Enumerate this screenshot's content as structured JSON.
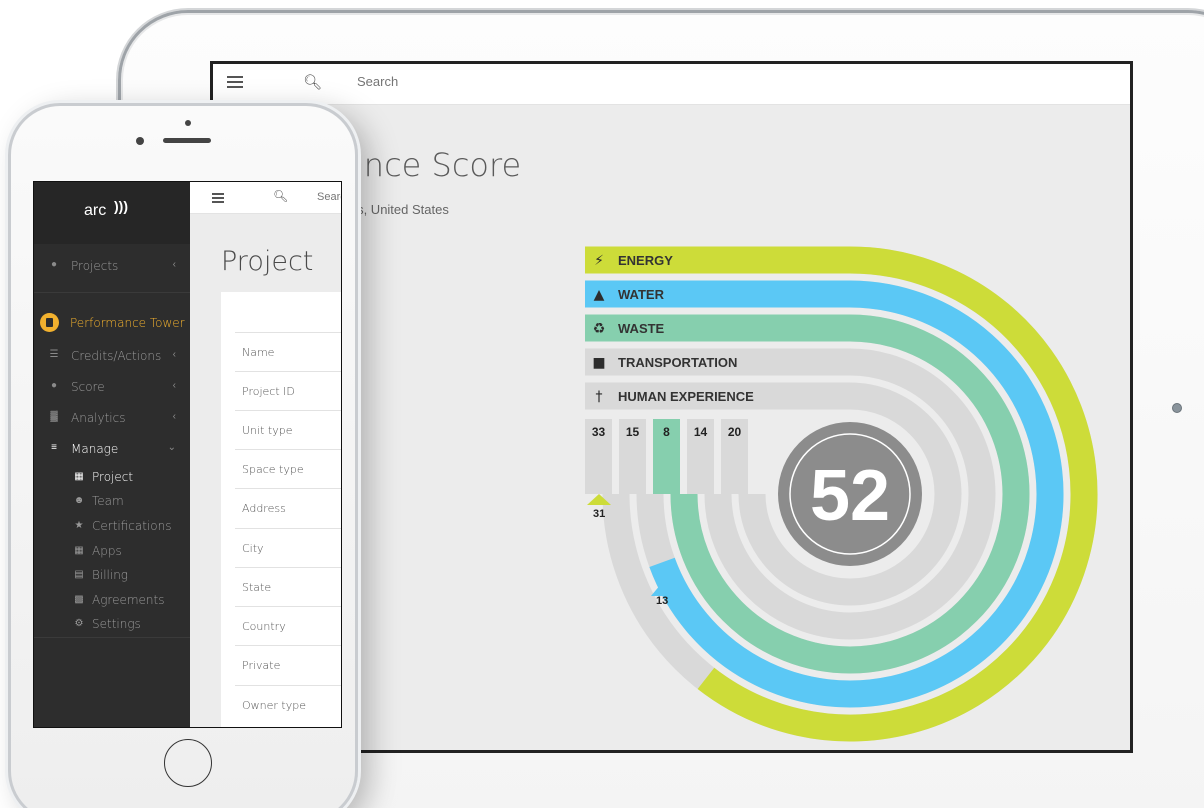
{
  "tablet": {
    "search_placeholder": "Search",
    "page_title": "mance Score",
    "location_text": "e, Illinois, United States",
    "categories": [
      {
        "label": "ENERGY",
        "icon": "lightning-bolt-icon",
        "color": "#cddc39",
        "score": 33,
        "max": 33
      },
      {
        "label": "WATER",
        "icon": "water-drop-icon",
        "color": "#5bc8f5",
        "score": 15,
        "max": 15
      },
      {
        "label": "WASTE",
        "icon": "recycle-icon",
        "color": "#86cfae",
        "score": 8,
        "max": 8
      },
      {
        "label": "TRANSPORTATION",
        "icon": "car-icon",
        "color": "#dadada",
        "score": 14,
        "max": 14
      },
      {
        "label": "HUMAN EXPERIENCE",
        "icon": "person-icon",
        "color": "#dadada",
        "score": 20,
        "max": 20
      }
    ],
    "arc_callouts": [
      {
        "category": "ENERGY",
        "value": "31"
      },
      {
        "category": "WATER",
        "value": "13"
      }
    ],
    "total_score": "52",
    "colors": {
      "energy": "#cddc39",
      "water": "#5bc8f5",
      "waste": "#86cfae",
      "track": "#d9d9d9",
      "center": "#8c8c8c"
    }
  },
  "phone": {
    "logo": "arc",
    "search_placeholder": "Search",
    "page_title": "Project",
    "nav": {
      "projects": "Projects",
      "project_name": "Performance Tower",
      "credits": "Credits/Actions",
      "score": "Score",
      "analytics": "Analytics",
      "manage": "Manage"
    },
    "manage_items": [
      {
        "label": "Project",
        "icon": "grid-icon"
      },
      {
        "label": "Team",
        "icon": "team-icon"
      },
      {
        "label": "Certifications",
        "icon": "star-icon"
      },
      {
        "label": "Apps",
        "icon": "grid-icon"
      },
      {
        "label": "Billing",
        "icon": "card-icon"
      },
      {
        "label": "Agreements",
        "icon": "document-icon"
      },
      {
        "label": "Settings",
        "icon": "gear-icon"
      }
    ],
    "fields": [
      "Name",
      "Project ID",
      "Unit type",
      "Space type",
      "Address",
      "City",
      "State",
      "Country",
      "Private",
      "Owner type"
    ]
  }
}
